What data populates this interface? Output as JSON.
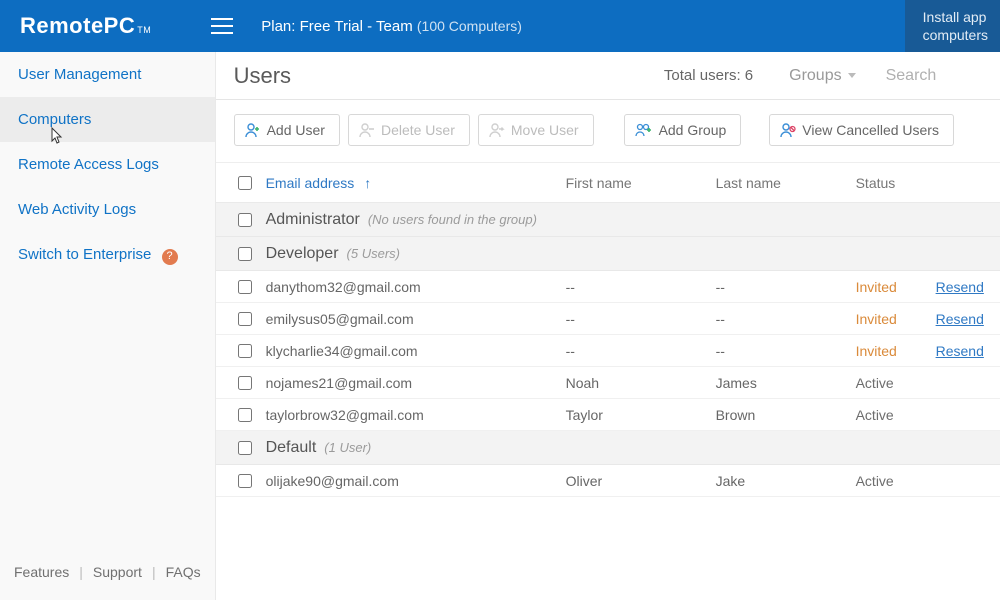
{
  "brand": "RemotePC",
  "brand_tm": "TM",
  "plan_prefix": "Plan: ",
  "plan_name": "Free Trial - Team",
  "plan_extra": "(100 Computers)",
  "install_line1": "Install app",
  "install_line2": "computers",
  "sidebar": {
    "items": [
      {
        "label": "User Management"
      },
      {
        "label": "Computers"
      },
      {
        "label": "Remote Access Logs"
      },
      {
        "label": "Web Activity Logs"
      },
      {
        "label": "Switch to Enterprise"
      }
    ],
    "help_badge": "?"
  },
  "footer": {
    "features": "Features",
    "support": "Support",
    "faqs": "FAQs"
  },
  "page": {
    "title": "Users",
    "total_label": "Total users: ",
    "total_value": "6",
    "groups_filter": "Groups",
    "search_placeholder": "Search"
  },
  "actions": {
    "add_user": "Add User",
    "delete_user": "Delete User",
    "move_user": "Move User",
    "add_group": "Add Group",
    "view_cancelled": "View Cancelled Users"
  },
  "columns": {
    "email": "Email address",
    "first": "First name",
    "last": "Last name",
    "status": "Status"
  },
  "sort_arrow": "↑",
  "placeholder_dash": "--",
  "resend_label": "Resend",
  "groups": [
    {
      "name": "Administrator",
      "count_label": "(No users found in the group)",
      "users": []
    },
    {
      "name": "Developer",
      "count_label": "(5 Users)",
      "users": [
        {
          "email": "danythom32@gmail.com",
          "first": "--",
          "last": "--",
          "status": "Invited",
          "resend": true
        },
        {
          "email": "emilysus05@gmail.com",
          "first": "--",
          "last": "--",
          "status": "Invited",
          "resend": true
        },
        {
          "email": "klycharlie34@gmail.com",
          "first": "--",
          "last": "--",
          "status": "Invited",
          "resend": true
        },
        {
          "email": "nojames21@gmail.com",
          "first": "Noah",
          "last": "James",
          "status": "Active",
          "resend": false
        },
        {
          "email": "taylorbrow32@gmail.com",
          "first": "Taylor",
          "last": "Brown",
          "status": "Active",
          "resend": false
        }
      ]
    },
    {
      "name": "Default",
      "count_label": "(1 User)",
      "users": [
        {
          "email": "olijake90@gmail.com",
          "first": "Oliver",
          "last": "Jake",
          "status": "Active",
          "resend": false
        }
      ]
    }
  ]
}
